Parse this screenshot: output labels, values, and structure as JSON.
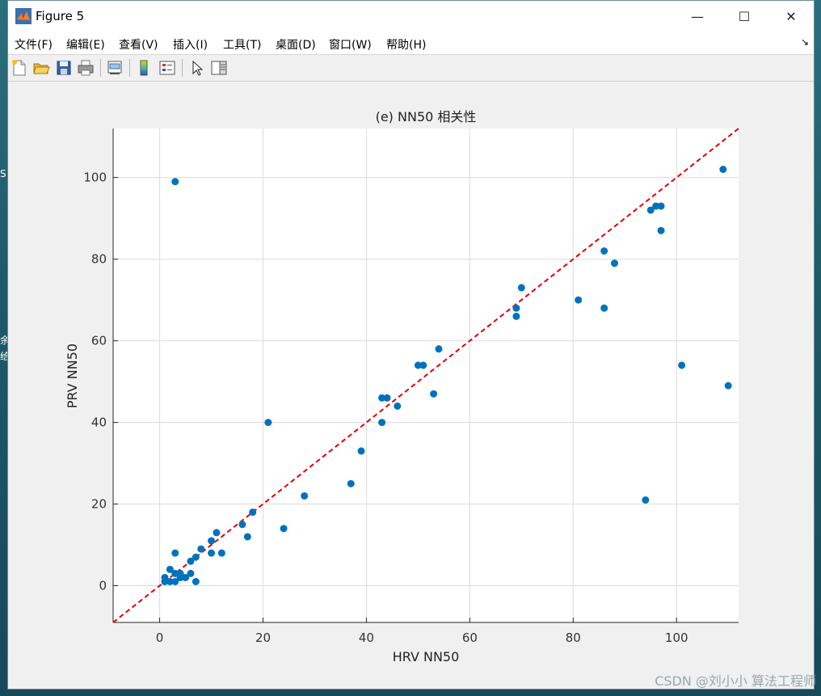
{
  "desktop": {
    "left_text_1": "S",
    "left_text_2": "余",
    "left_text_3": "给"
  },
  "window": {
    "title": "Figure 5",
    "controls": {
      "minimize": "—",
      "maximize": "☐",
      "close": "✕"
    }
  },
  "menubar": {
    "items": [
      {
        "label": "文件(F)"
      },
      {
        "label": "编辑(E)"
      },
      {
        "label": "查看(V)"
      },
      {
        "label": "插入(I)"
      },
      {
        "label": "工具(T)"
      },
      {
        "label": "桌面(D)"
      },
      {
        "label": "窗口(W)"
      },
      {
        "label": "帮助(H)"
      }
    ],
    "overflow_icon": "↘"
  },
  "toolbar": {
    "icons": [
      "new-figure-icon",
      "open-file-icon",
      "save-icon",
      "print-icon",
      "link-plot-icon",
      "colorbar-icon",
      "legend-icon",
      "pointer-icon",
      "property-inspector-icon"
    ]
  },
  "colors": {
    "marker": "#0072bd",
    "refline": "#e00000",
    "grid": "#dcdcdc",
    "plot_bg": "#ffffff"
  },
  "chart_data": {
    "type": "scatter",
    "title": "(e) NN50 相关性",
    "xlabel": "HRV NN50",
    "ylabel": "PRV NN50",
    "xlim": [
      -9,
      112
    ],
    "ylim": [
      -9,
      112
    ],
    "xticks": [
      0,
      20,
      40,
      60,
      80,
      100
    ],
    "yticks": [
      0,
      20,
      40,
      60,
      80,
      100
    ],
    "grid": true,
    "series": [
      {
        "x": [
          3,
          1,
          1,
          2,
          2,
          3,
          3,
          3,
          4,
          4,
          5,
          6,
          6,
          7,
          7,
          8,
          10,
          10,
          11,
          12,
          16,
          17,
          18,
          21,
          24,
          28,
          37,
          39,
          43,
          43,
          44,
          46,
          50,
          51,
          53,
          54,
          69,
          69,
          70,
          81,
          86,
          86,
          88,
          94,
          95,
          96,
          97,
          97,
          101,
          109,
          110
        ],
        "y": [
          99,
          2,
          1,
          4,
          1,
          8,
          3,
          1,
          3,
          2,
          2,
          6,
          3,
          7,
          1,
          9,
          11,
          8,
          13,
          8,
          15,
          12,
          18,
          40,
          14,
          22,
          25,
          33,
          46,
          40,
          46,
          44,
          54,
          54,
          47,
          58,
          68,
          66,
          73,
          70,
          82,
          68,
          79,
          21,
          92,
          93,
          93,
          87,
          54,
          102,
          49
        ]
      }
    ],
    "reference_line": {
      "from": [
        -9,
        -9
      ],
      "to": [
        112,
        112
      ],
      "style": "dashed"
    }
  },
  "watermark": "CSDN @刘小小 算法工程师"
}
